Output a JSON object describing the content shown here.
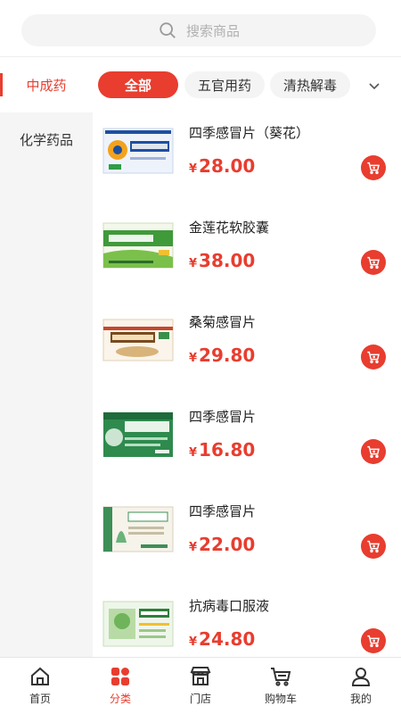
{
  "search": {
    "placeholder": "搜索商品"
  },
  "categories": {
    "active": "中成药",
    "sidebar": [
      "化学药品"
    ]
  },
  "chips": [
    {
      "label": "全部",
      "active": true
    },
    {
      "label": "五官用药",
      "active": false
    },
    {
      "label": "清热解毒",
      "active": false
    }
  ],
  "currency": "¥",
  "products": [
    {
      "name": "四季感冒片（葵花）",
      "price": "28.00"
    },
    {
      "name": "金莲花软胶囊",
      "price": "38.00"
    },
    {
      "name": "桑菊感冒片",
      "price": "29.80"
    },
    {
      "name": "四季感冒片",
      "price": "16.80"
    },
    {
      "name": "四季感冒片",
      "price": "22.00"
    },
    {
      "name": "抗病毒口服液",
      "price": "24.80"
    }
  ],
  "tabs": [
    {
      "label": "首页",
      "icon": "home-icon"
    },
    {
      "label": "分类",
      "icon": "category-icon",
      "active": true
    },
    {
      "label": "门店",
      "icon": "store-icon"
    },
    {
      "label": "购物车",
      "icon": "cart-icon"
    },
    {
      "label": "我的",
      "icon": "user-icon"
    }
  ],
  "colors": {
    "accent": "#e83d2f"
  }
}
